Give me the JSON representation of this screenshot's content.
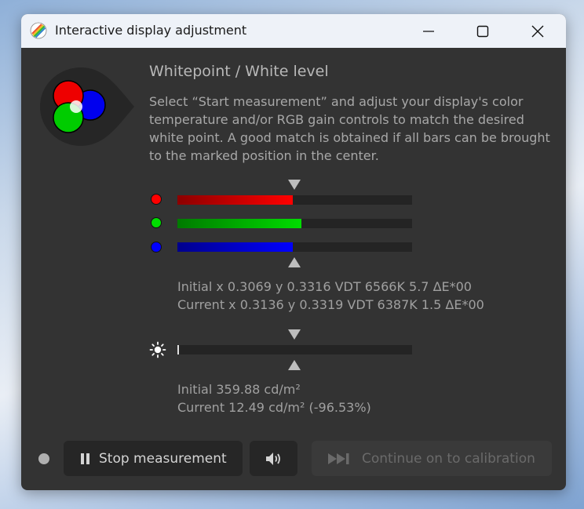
{
  "window": {
    "title": "Interactive display adjustment",
    "controls": {
      "minimize_icon": "minimize-icon",
      "maximize_icon": "maximize-icon",
      "close_icon": "close-icon"
    }
  },
  "content": {
    "heading": "Whitepoint / White level",
    "description": "Select “Start measurement” and adjust your display's color temperature and/or RGB gain controls to match the desired white point. A good match is obtained if all bars can be brought to the marked position in the center."
  },
  "rgb_bars": [
    {
      "channel": "red",
      "color": "#ff0000",
      "level": 0.49
    },
    {
      "channel": "green",
      "color": "#00dd00",
      "level": 0.53
    },
    {
      "channel": "blue",
      "color": "#0000ff",
      "level": 0.49
    }
  ],
  "whitepoint": {
    "initial": "Initial x 0.3069 y 0.3316 VDT 6566K 5.7 ΔE*00",
    "current": "Current x 0.3136 y 0.3319 VDT 6387K 1.5 ΔE*00"
  },
  "luminance": {
    "icon": "brightness-icon",
    "level": 0.005,
    "initial": "Initial 359.88 cd/m²",
    "current": "Current 12.49 cd/m² (-96.53%)"
  },
  "buttons": {
    "stop": "Stop measurement",
    "stop_icon": "pause-icon",
    "sound_icon": "speaker-icon",
    "continue": "Continue on to calibration",
    "continue_icon": "skip-forward-icon"
  },
  "colors": {
    "window_bg": "#333333",
    "track_bg": "#242424",
    "marker": "#bdbdbd"
  }
}
